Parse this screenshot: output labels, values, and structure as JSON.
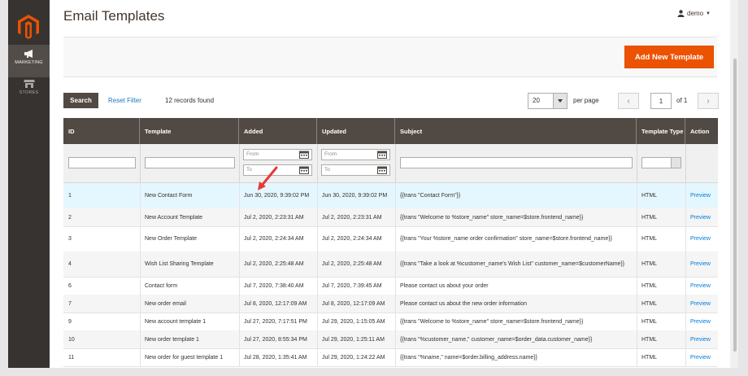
{
  "page": {
    "title": "Email Templates",
    "user": "demo"
  },
  "sidebar": {
    "items": [
      {
        "label": "MARKETING",
        "icon": "megaphone-icon"
      },
      {
        "label": "STORES",
        "icon": "store-icon"
      }
    ]
  },
  "actions": {
    "add_new": "Add New Template",
    "search": "Search",
    "reset_filter": "Reset Filter",
    "records_found": "12 records found"
  },
  "pager": {
    "per_page_value": "20",
    "per_page_label": "per page",
    "current_page": "1",
    "of_pages": "of 1"
  },
  "filters": {
    "from_placeholder": "From",
    "to_placeholder": "To"
  },
  "columns": [
    {
      "label": "ID"
    },
    {
      "label": "Template"
    },
    {
      "label": "Added"
    },
    {
      "label": "Updated"
    },
    {
      "label": "Subject"
    },
    {
      "label": "Template Type"
    },
    {
      "label": "Action"
    }
  ],
  "rows": [
    {
      "id": "1",
      "template": "New Contact Form",
      "added": "Jun 30, 2020, 9:39:02 PM",
      "updated": "Jun 30, 2020, 9:39:02 PM",
      "subject": "{{trans \"Contact Form\"}}",
      "type": "HTML",
      "action": "Preview"
    },
    {
      "id": "2",
      "template": "New Account Template",
      "added": "Jul 2, 2020, 2:23:31 AM",
      "updated": "Jul 2, 2020, 2:23:31 AM",
      "subject": "{{trans \"Welcome to %store_name\" store_name=$store.frontend_name}}",
      "type": "HTML",
      "action": "Preview"
    },
    {
      "id": "3",
      "template": "New Order Template",
      "added": "Jul 2, 2020, 2:24:34 AM",
      "updated": "Jul 2, 2020, 2:24:34 AM",
      "subject": "{{trans \"Your %store_name order confirmation\" store_name=$store.frontend_name}}",
      "type": "HTML",
      "action": "Preview"
    },
    {
      "id": "4",
      "template": "Wish List Sharing Template",
      "added": "Jul 2, 2020, 2:25:48 AM",
      "updated": "Jul 2, 2020, 2:25:48 AM",
      "subject": "{{trans \"Take a look at %customer_name's Wish List\" customer_name=$customerName}}",
      "type": "HTML",
      "action": "Preview"
    },
    {
      "id": "6",
      "template": "Contact form",
      "added": "Jul 7, 2020, 7:38:40 AM",
      "updated": "Jul 7, 2020, 7:39:45 AM",
      "subject": "Please contact us about your order",
      "type": "HTML",
      "action": "Preview"
    },
    {
      "id": "7",
      "template": "New order email",
      "added": "Jul 8, 2020, 12:17:09 AM",
      "updated": "Jul 8, 2020, 12:17:09 AM",
      "subject": "Please contact us about the new order information",
      "type": "HTML",
      "action": "Preview"
    },
    {
      "id": "9",
      "template": "New account template 1",
      "added": "Jul 27, 2020, 7:17:51 PM",
      "updated": "Jul 29, 2020, 1:15:05 AM",
      "subject": "{{trans \"Welcome to %store_name\" store_name=$store.frontend_name}}",
      "type": "HTML",
      "action": "Preview"
    },
    {
      "id": "10",
      "template": "New order template 1",
      "added": "Jul 27, 2020, 8:55:34 PM",
      "updated": "Jul 29, 2020, 1:25:11 AM",
      "subject": "{{trans \"%customer_name,\" customer_name=$order_data.customer_name}}",
      "type": "HTML",
      "action": "Preview"
    },
    {
      "id": "11",
      "template": "New order for guest template 1",
      "added": "Jul 28, 2020, 1:35:41 AM",
      "updated": "Jul 29, 2020, 1:24:22 AM",
      "subject": "{{trans \"%name,\" name=$order.billing_address.name}}",
      "type": "HTML",
      "action": "Preview"
    }
  ],
  "colors": {
    "accent": "#eb5202",
    "header": "#514943",
    "link": "#007bdb",
    "sidebar": "#373330"
  }
}
